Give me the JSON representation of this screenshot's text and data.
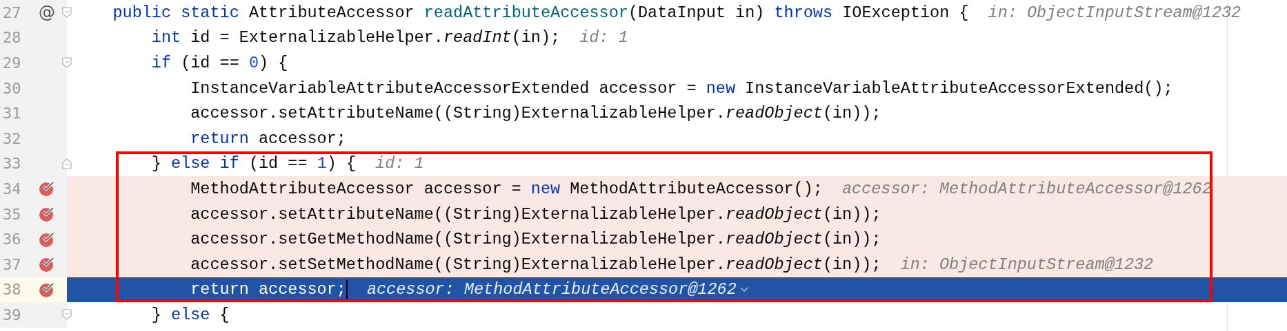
{
  "editor": {
    "lines": [
      {
        "number": "27",
        "marker": "@",
        "fold_start": true,
        "fold_end": false,
        "breakpoint": false,
        "current": false,
        "boxed": false,
        "tokens": [
          {
            "kind": "keyword",
            "text": "    public"
          },
          {
            "kind": "keyword",
            "text": " static"
          },
          {
            "kind": "plain",
            "text": " AttributeAccessor "
          },
          {
            "kind": "declaration",
            "text": "readAttributeAccessor"
          },
          {
            "kind": "plain",
            "text": "(DataInput in) "
          },
          {
            "kind": "keyword",
            "text": "throws"
          },
          {
            "kind": "plain",
            "text": " IOException {"
          }
        ],
        "hint": "in: ObjectInputStream@1232"
      },
      {
        "number": "28",
        "fold_start": false,
        "fold_end": false,
        "breakpoint": false,
        "current": false,
        "boxed": false,
        "tokens": [
          {
            "kind": "keyword",
            "text": "        int"
          },
          {
            "kind": "plain",
            "text": " id = ExternalizableHelper."
          },
          {
            "kind": "static-call",
            "text": "readInt"
          },
          {
            "kind": "plain",
            "text": "(in);"
          }
        ],
        "hint": "id: 1"
      },
      {
        "number": "29",
        "fold_start": true,
        "fold_end": false,
        "breakpoint": false,
        "current": false,
        "boxed": false,
        "tokens": [
          {
            "kind": "keyword",
            "text": "        if"
          },
          {
            "kind": "plain",
            "text": " (id == "
          },
          {
            "kind": "number",
            "text": "0"
          },
          {
            "kind": "plain",
            "text": ") {"
          }
        ]
      },
      {
        "number": "30",
        "fold_start": false,
        "fold_end": false,
        "breakpoint": false,
        "current": false,
        "boxed": false,
        "tokens": [
          {
            "kind": "plain",
            "text": "            InstanceVariableAttributeAccessorExtended accessor = "
          },
          {
            "kind": "keyword",
            "text": "new"
          },
          {
            "kind": "plain",
            "text": " InstanceVariableAttributeAccessorExtended();"
          }
        ]
      },
      {
        "number": "31",
        "fold_start": false,
        "fold_end": false,
        "breakpoint": false,
        "current": false,
        "boxed": false,
        "tokens": [
          {
            "kind": "plain",
            "text": "            accessor.setAttributeName((String)ExternalizableHelper."
          },
          {
            "kind": "static-call",
            "text": "readObject"
          },
          {
            "kind": "plain",
            "text": "(in));"
          }
        ]
      },
      {
        "number": "32",
        "fold_start": false,
        "fold_end": false,
        "breakpoint": false,
        "current": false,
        "boxed": false,
        "tokens": [
          {
            "kind": "keyword",
            "text": "            return"
          },
          {
            "kind": "plain",
            "text": " accessor;"
          }
        ]
      },
      {
        "number": "33",
        "fold_start": false,
        "fold_end": true,
        "breakpoint": false,
        "current": false,
        "boxed": true,
        "tokens": [
          {
            "kind": "plain",
            "text": "        } "
          },
          {
            "kind": "keyword",
            "text": "else"
          },
          {
            "kind": "keyword",
            "text": " if"
          },
          {
            "kind": "plain",
            "text": " (id == "
          },
          {
            "kind": "number",
            "text": "1"
          },
          {
            "kind": "plain",
            "text": ") {"
          }
        ],
        "hint": "id: 1"
      },
      {
        "number": "34",
        "fold_start": false,
        "fold_end": false,
        "breakpoint": true,
        "current": false,
        "boxed": true,
        "tokens": [
          {
            "kind": "plain",
            "text": "            MethodAttributeAccessor accessor = "
          },
          {
            "kind": "keyword",
            "text": "new"
          },
          {
            "kind": "plain",
            "text": " MethodAttributeAccessor();"
          }
        ],
        "hint": "accessor: MethodAttributeAccessor@1262"
      },
      {
        "number": "35",
        "fold_start": false,
        "fold_end": false,
        "breakpoint": true,
        "current": false,
        "boxed": true,
        "tokens": [
          {
            "kind": "plain",
            "text": "            accessor.setAttributeName((String)ExternalizableHelper."
          },
          {
            "kind": "static-call",
            "text": "readObject"
          },
          {
            "kind": "plain",
            "text": "(in));"
          }
        ]
      },
      {
        "number": "36",
        "fold_start": false,
        "fold_end": false,
        "breakpoint": true,
        "current": false,
        "boxed": true,
        "tokens": [
          {
            "kind": "plain",
            "text": "            accessor.setGetMethodName((String)ExternalizableHelper."
          },
          {
            "kind": "static-call",
            "text": "readObject"
          },
          {
            "kind": "plain",
            "text": "(in));"
          }
        ]
      },
      {
        "number": "37",
        "fold_start": false,
        "fold_end": false,
        "breakpoint": true,
        "current": false,
        "boxed": true,
        "tokens": [
          {
            "kind": "plain",
            "text": "            accessor.setSetMethodName((String)ExternalizableHelper."
          },
          {
            "kind": "static-call",
            "text": "readObject"
          },
          {
            "kind": "plain",
            "text": "(in));"
          }
        ],
        "hint": "in: ObjectInputStream@1232"
      },
      {
        "number": "38",
        "fold_start": false,
        "fold_end": false,
        "breakpoint": true,
        "current": true,
        "caret": true,
        "boxed": true,
        "tokens": [
          {
            "kind": "keyword",
            "text": "            return"
          },
          {
            "kind": "plain",
            "text": " accessor;"
          }
        ],
        "hint": "accessor: MethodAttributeAccessor@1262",
        "hint_expandable": true
      },
      {
        "number": "39",
        "fold_start": true,
        "fold_end": false,
        "breakpoint": false,
        "current": false,
        "boxed": false,
        "tokens": [
          {
            "kind": "plain",
            "text": "        } "
          },
          {
            "kind": "keyword",
            "text": "else"
          },
          {
            "kind": "plain",
            "text": " {"
          }
        ]
      }
    ]
  }
}
